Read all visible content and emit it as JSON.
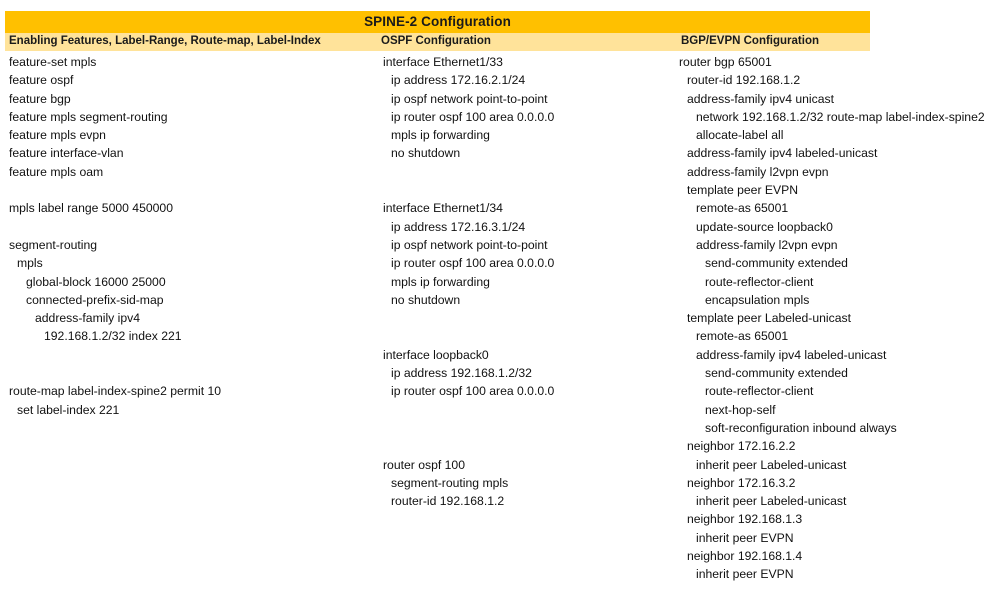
{
  "title": "SPINE-2 Configuration",
  "colors": {
    "title_band": "#FFC000",
    "header_band": "#FFE39A",
    "text": "#111111"
  },
  "headers": {
    "col1": "Enabling Features, Label-Range, Route-map, Label-Index",
    "col2": "OSPF Configuration",
    "col3": "BGP/EVPN Configuration"
  },
  "columns": {
    "col1": [
      {
        "text": "feature-set mpls",
        "indent": 0
      },
      {
        "text": "feature ospf",
        "indent": 0
      },
      {
        "text": "feature bgp",
        "indent": 0
      },
      {
        "text": "feature mpls segment-routing",
        "indent": 0
      },
      {
        "text": "feature mpls evpn",
        "indent": 0
      },
      {
        "text": "feature interface-vlan",
        "indent": 0
      },
      {
        "text": "feature mpls oam",
        "indent": 0
      },
      {
        "text": "",
        "indent": 0
      },
      {
        "text": "mpls label range 5000 450000",
        "indent": 0
      },
      {
        "text": "",
        "indent": 0
      },
      {
        "text": "segment-routing",
        "indent": 0
      },
      {
        "text": "mpls",
        "indent": 1
      },
      {
        "text": "global-block 16000 25000",
        "indent": 2
      },
      {
        "text": "connected-prefix-sid-map",
        "indent": 2
      },
      {
        "text": "address-family ipv4",
        "indent": 3
      },
      {
        "text": "192.168.1.2/32 index 221",
        "indent": 4
      },
      {
        "text": "",
        "indent": 0
      },
      {
        "text": "",
        "indent": 0
      },
      {
        "text": "route-map label-index-spine2 permit 10",
        "indent": 0
      },
      {
        "text": "set label-index 221",
        "indent": 1
      }
    ],
    "col2": [
      {
        "text": "interface Ethernet1/33",
        "indent": 0
      },
      {
        "text": "ip address 172.16.2.1/24",
        "indent": 1
      },
      {
        "text": "ip ospf network point-to-point",
        "indent": 1
      },
      {
        "text": "ip router ospf 100 area 0.0.0.0",
        "indent": 1
      },
      {
        "text": "mpls ip forwarding",
        "indent": 1
      },
      {
        "text": "no shutdown",
        "indent": 1
      },
      {
        "text": "",
        "indent": 0
      },
      {
        "text": "",
        "indent": 0
      },
      {
        "text": "interface Ethernet1/34",
        "indent": 0
      },
      {
        "text": "ip address 172.16.3.1/24",
        "indent": 1
      },
      {
        "text": "ip ospf network point-to-point",
        "indent": 1
      },
      {
        "text": "ip router ospf 100 area 0.0.0.0",
        "indent": 1
      },
      {
        "text": "mpls ip forwarding",
        "indent": 1
      },
      {
        "text": "no shutdown",
        "indent": 1
      },
      {
        "text": "",
        "indent": 0
      },
      {
        "text": "",
        "indent": 0
      },
      {
        "text": "interface loopback0",
        "indent": 0
      },
      {
        "text": "ip address 192.168.1.2/32",
        "indent": 1
      },
      {
        "text": "ip router ospf 100 area 0.0.0.0",
        "indent": 1
      },
      {
        "text": "",
        "indent": 0
      },
      {
        "text": "",
        "indent": 0
      },
      {
        "text": "",
        "indent": 0
      },
      {
        "text": "router ospf 100",
        "indent": 0
      },
      {
        "text": "segment-routing mpls",
        "indent": 1
      },
      {
        "text": "router-id 192.168.1.2",
        "indent": 1
      }
    ],
    "col3": [
      {
        "text": "router bgp 65001",
        "indent": 0
      },
      {
        "text": "router-id 192.168.1.2",
        "indent": 1
      },
      {
        "text": "address-family ipv4 unicast",
        "indent": 1
      },
      {
        "text": "network 192.168.1.2/32 route-map label-index-spine2",
        "indent": 2
      },
      {
        "text": "allocate-label all",
        "indent": 2
      },
      {
        "text": "address-family ipv4 labeled-unicast",
        "indent": 1
      },
      {
        "text": "address-family l2vpn evpn",
        "indent": 1
      },
      {
        "text": "template peer EVPN",
        "indent": 1
      },
      {
        "text": "remote-as 65001",
        "indent": 2
      },
      {
        "text": "update-source loopback0",
        "indent": 2
      },
      {
        "text": "address-family l2vpn evpn",
        "indent": 2
      },
      {
        "text": "send-community extended",
        "indent": 3
      },
      {
        "text": "route-reflector-client",
        "indent": 3
      },
      {
        "text": "encapsulation mpls",
        "indent": 3
      },
      {
        "text": "template peer Labeled-unicast",
        "indent": 1
      },
      {
        "text": "remote-as 65001",
        "indent": 2
      },
      {
        "text": "address-family ipv4 labeled-unicast",
        "indent": 2
      },
      {
        "text": "send-community extended",
        "indent": 3
      },
      {
        "text": "route-reflector-client",
        "indent": 3
      },
      {
        "text": "next-hop-self",
        "indent": 3
      },
      {
        "text": "soft-reconfiguration inbound always",
        "indent": 3
      },
      {
        "text": "neighbor 172.16.2.2",
        "indent": 1
      },
      {
        "text": "inherit peer Labeled-unicast",
        "indent": 2
      },
      {
        "text": "neighbor 172.16.3.2",
        "indent": 1
      },
      {
        "text": "inherit peer Labeled-unicast",
        "indent": 2
      },
      {
        "text": "neighbor 192.168.1.3",
        "indent": 1
      },
      {
        "text": "inherit peer EVPN",
        "indent": 2
      },
      {
        "text": "neighbor 192.168.1.4",
        "indent": 1
      },
      {
        "text": "inherit peer EVPN",
        "indent": 2
      }
    ]
  }
}
